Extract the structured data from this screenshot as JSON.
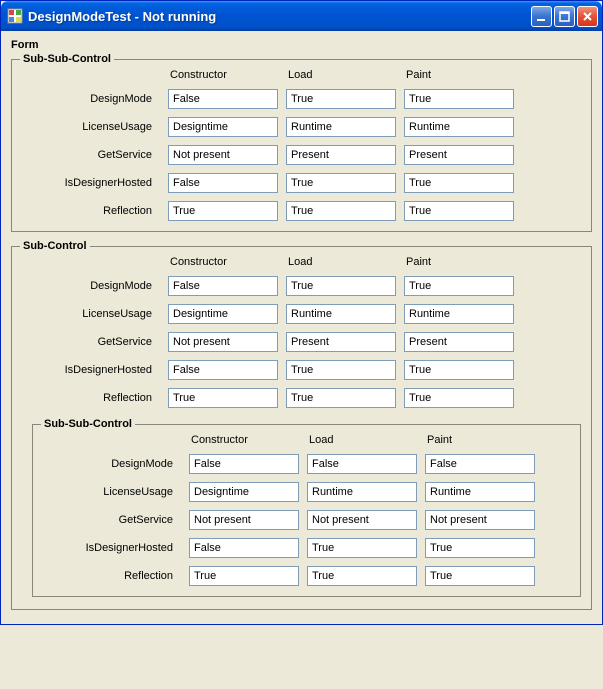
{
  "window": {
    "title": "DesignModeTest - Not running"
  },
  "form_label": "Form",
  "columns": {
    "c1": "Constructor",
    "c2": "Load",
    "c3": "Paint"
  },
  "rows": {
    "r1": "DesignMode",
    "r2": "LicenseUsage",
    "r3": "GetService",
    "r4": "IsDesignerHosted",
    "r5": "Reflection"
  },
  "groups": {
    "g1": {
      "title": "Sub-Sub-Control",
      "vals": {
        "r1": {
          "c1": "False",
          "c2": "True",
          "c3": "True"
        },
        "r2": {
          "c1": "Designtime",
          "c2": "Runtime",
          "c3": "Runtime"
        },
        "r3": {
          "c1": "Not present",
          "c2": "Present",
          "c3": "Present"
        },
        "r4": {
          "c1": "False",
          "c2": "True",
          "c3": "True"
        },
        "r5": {
          "c1": "True",
          "c2": "True",
          "c3": "True"
        }
      }
    },
    "g2": {
      "title": "Sub-Control",
      "vals": {
        "r1": {
          "c1": "False",
          "c2": "True",
          "c3": "True"
        },
        "r2": {
          "c1": "Designtime",
          "c2": "Runtime",
          "c3": "Runtime"
        },
        "r3": {
          "c1": "Not present",
          "c2": "Present",
          "c3": "Present"
        },
        "r4": {
          "c1": "False",
          "c2": "True",
          "c3": "True"
        },
        "r5": {
          "c1": "True",
          "c2": "True",
          "c3": "True"
        }
      },
      "nested": {
        "title": "Sub-Sub-Control",
        "vals": {
          "r1": {
            "c1": "False",
            "c2": "False",
            "c3": "False"
          },
          "r2": {
            "c1": "Designtime",
            "c2": "Runtime",
            "c3": "Runtime"
          },
          "r3": {
            "c1": "Not present",
            "c2": "Not present",
            "c3": "Not present"
          },
          "r4": {
            "c1": "False",
            "c2": "True",
            "c3": "True"
          },
          "r5": {
            "c1": "True",
            "c2": "True",
            "c3": "True"
          }
        }
      }
    }
  }
}
